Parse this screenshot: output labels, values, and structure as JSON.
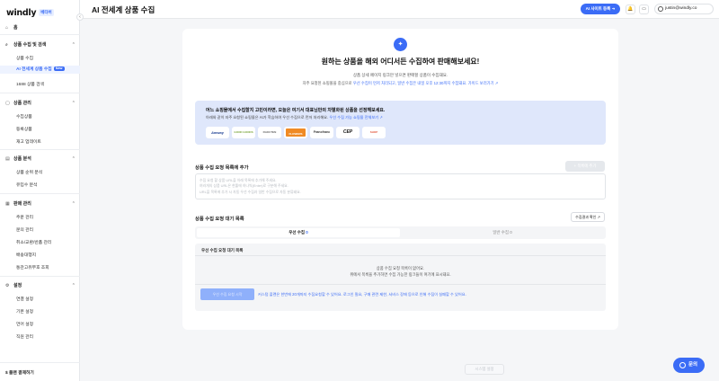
{
  "brand": {
    "name": "windly",
    "badge": "베타버"
  },
  "sidebar": {
    "home": "홈",
    "sections": [
      {
        "label": "상품 수집 및 검색",
        "items": [
          "상품 수집",
          "AI 전세계 상품 수집",
          "1688 상품 검색"
        ],
        "active_badge": "New"
      },
      {
        "label": "상품 관리",
        "items": [
          "수집상품",
          "등록상품",
          "재고 업데이트"
        ]
      },
      {
        "label": "상품 분석",
        "items": [
          "상품 순위 분석",
          "유입수 분석"
        ]
      },
      {
        "label": "판매 관리",
        "items": [
          "주문 관리",
          "문의 관리",
          "취소/교환/반품 관리",
          "배송대행지",
          "통관고유부호 조회"
        ]
      },
      {
        "label": "설정",
        "items": [
          "연결 설정",
          "기본 설정",
          "언어 설정",
          "직원 관리"
        ]
      }
    ],
    "footer": "플랜 결제하기"
  },
  "header": {
    "title": "AI 전세계 상품 수집",
    "site_button": "AI 사이트 등록",
    "user": "justin@windly.co"
  },
  "hero": {
    "title": "원하는 상품을 해외 어디서든 수집하여 판매해보세요!",
    "sub1": "상품 상세 페이지 링크만 넣으면 판매할 상품이 수집돼요.",
    "sub2_a": "자주 요청된 쇼핑몰을 중심으로",
    "sub2_b": "우선 수집이 먼저 처리되고, 일반 수집은 내일 오후 12:30까지 수집돼요.",
    "sub2_c": "가이드 보러가기"
  },
  "info": {
    "title": "어느 쇼핑몰에서 수집할지 고민이라면, 오늘은 여기서 대표님만의 차별화된 상품을 선정해보세요.",
    "desc": "아래와 같이 자주 요청된 쇼핑몰은 AI가 학습하여 우선 수집으로 먼저 처리해요.",
    "link": "우선 수집 가능 쇼핑몰 전체보기",
    "malls": [
      "Amway",
      "GOOD GOODS",
      "RAKUTEN",
      "FLOWERS",
      "Francfranc",
      "CEP",
      "SHOP"
    ]
  },
  "add_section": {
    "title": "상품 수집 요청 목록에 추가",
    "add_button": "목록에 추가",
    "placeholder_lines": [
      "수집 요청 할 상품 URL을 아래 목록에 추가해 주세요.",
      "여러개의 상품 URL은 한줄에 하나씩(Enter)로 구분해 주세요.",
      "URL을 목록에 추가 시 자동 우선 수집과 일반 수집으로 자동 분류돼요."
    ]
  },
  "queue_section": {
    "title": "상품 수집 요청 대기 목록",
    "view_button": "수집결과 확인",
    "tab_priority": "우선 수집",
    "tab_priority_count": "0",
    "tab_general": "일반 수집",
    "tab_general_count": "0",
    "list_title": "우선 수집 요청 대기 목록",
    "empty1": "상품 수집 요청 목록이 없어요.",
    "empty2": "위에서 목록을 추가하면 수집 가능한 링크들이 여기에 표시돼요.",
    "start_button": "우선 수집 요청 시작",
    "warning": "커스텀 플랜은 한번에 20개까지 수집요청할 수 있어요. 로그인 필요, 구매 관련 제한, 서비스 장애 등으로 인해 수집이 실패할 수 있어요."
  },
  "footer_button": "시스템 설정",
  "chat_button": "문의"
}
